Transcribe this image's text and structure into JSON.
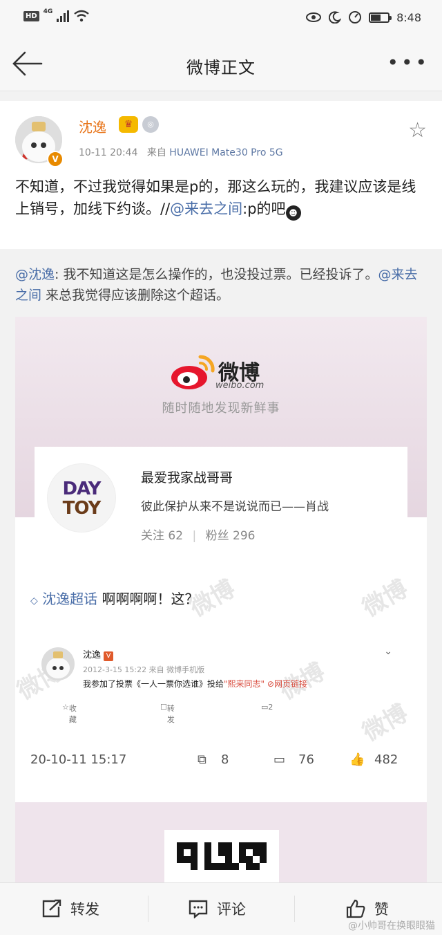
{
  "status_bar": {
    "network": "4G",
    "hd": "HD",
    "time": "8:48",
    "battery_level": 0.6
  },
  "nav": {
    "title": "微博正文",
    "more": "•••"
  },
  "post": {
    "author": "沈逸",
    "verified_badge": "V",
    "timestamp": "10-11 20:44",
    "source_prefix": "来自",
    "source": "HUAWEI Mate30 Pro 5G",
    "text": "不知道，不过我觉得如果是p的，那这么玩的，我建议应该是线上销号，加线下约谈。//",
    "mention": "@来去之间",
    "text_tail": ":p的吧"
  },
  "retweet": {
    "mention": "@沈逸",
    "text": ": 我不知道这是怎么操作的，也没投过票。已经投诉了。",
    "mention2": "@来去之间",
    "text2": " 来总我觉得应该删除这个超话。"
  },
  "screenshot": {
    "brand": "微博",
    "domain": "weibo.com",
    "slogan": "随时随地发现新鲜事",
    "card": {
      "avatar_line1": "DAY",
      "avatar_line2": "TOY",
      "name": "最爱我家战哥哥",
      "signature": "彼此保护从来不是说说而已——肖战",
      "follow_label": "关注",
      "follow_count": "62",
      "fans_label": "粉丝",
      "fans_count": "296"
    },
    "topic": "沈逸超话",
    "topic_text": " 啊啊啊啊！这？",
    "inner_post": {
      "author": "沈逸",
      "time": "2012-3-15 15:22 来自 微博手机版",
      "text_prefix": "我参加了投票《一人一票你选谁》投给",
      "text_highlight": "\"熙来同志\"",
      "link": "网页链接",
      "action_fav": "收藏",
      "action_repost": "转发",
      "action_comment": "2"
    },
    "footer_time": "20-10-11 15:17",
    "footer_reposts": "8",
    "footer_comments": "76",
    "footer_likes": "482"
  },
  "bottom_bar": {
    "repost": "转发",
    "comment": "评论",
    "like": "赞",
    "watermark": "@小帅哥在换眼眼猫"
  }
}
